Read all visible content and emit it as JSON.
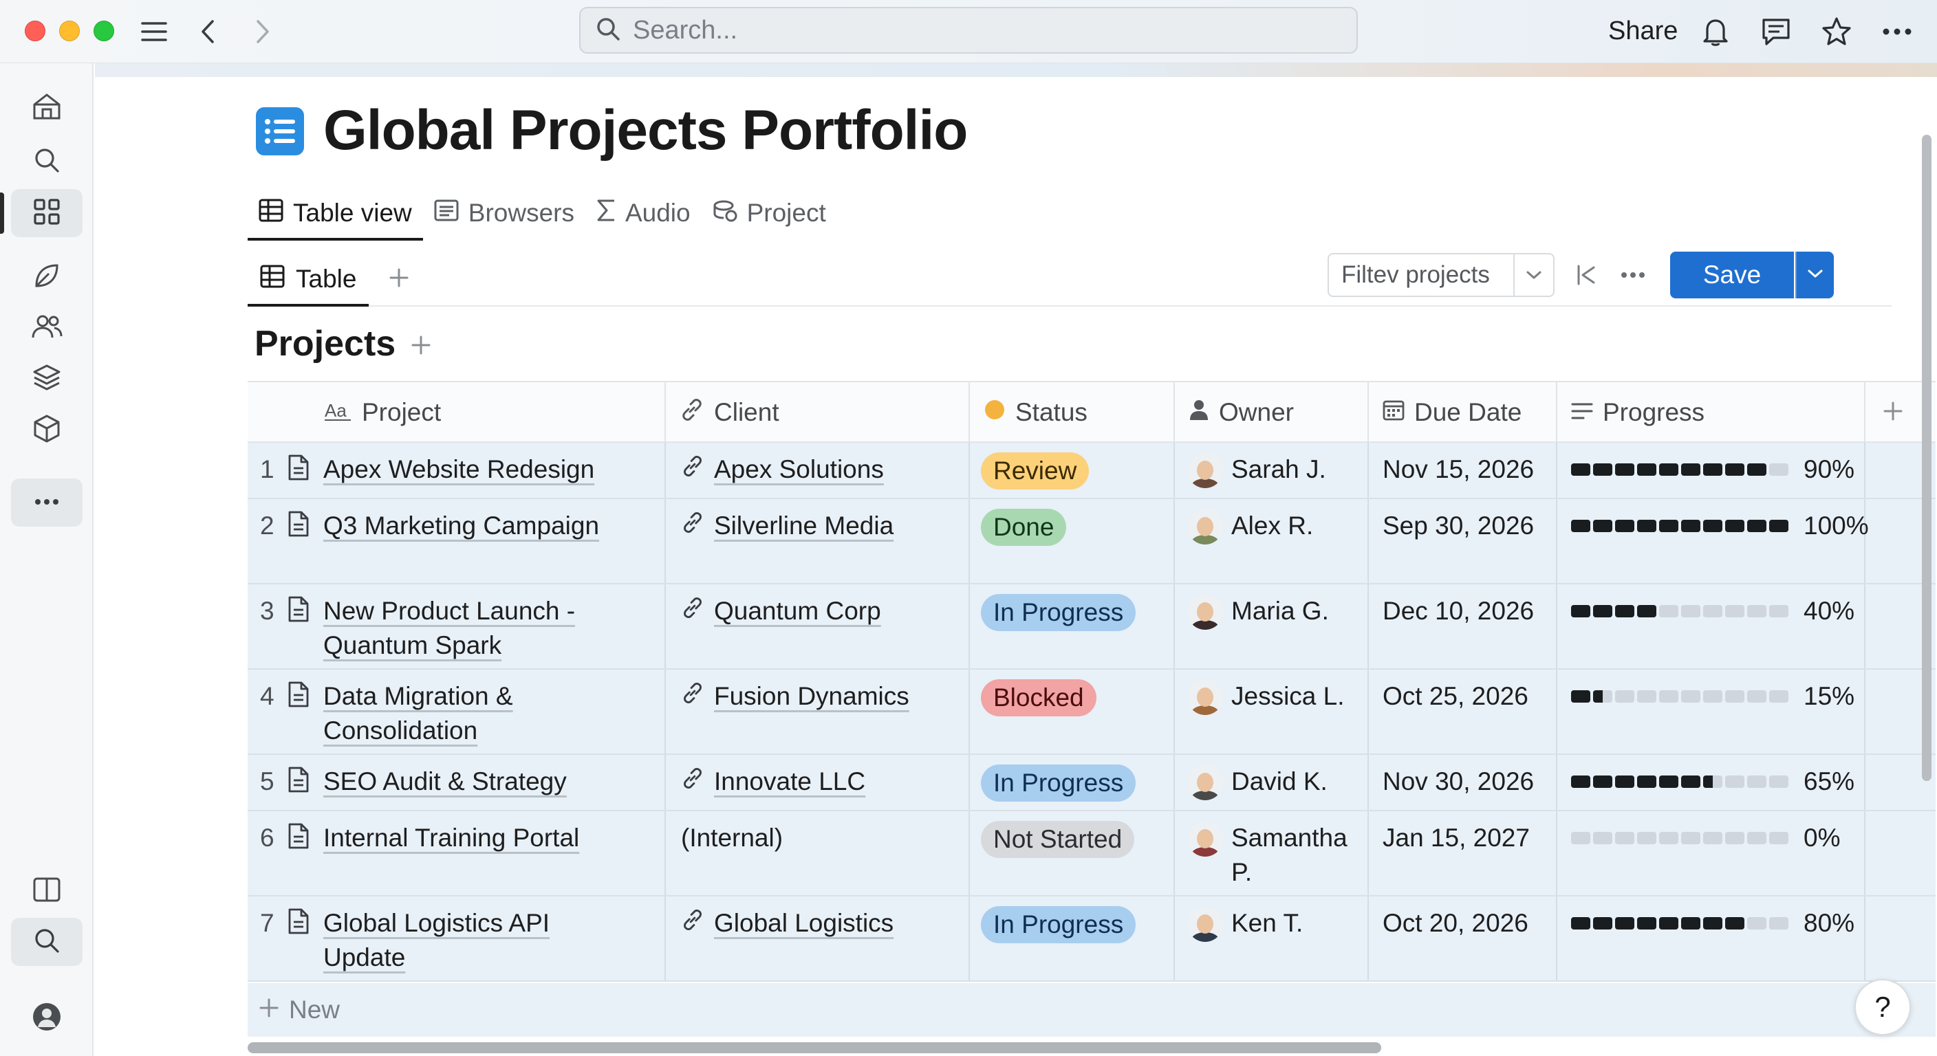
{
  "titlebar": {
    "search_placeholder": "Search...",
    "share_label": "Share"
  },
  "page": {
    "title": "Global Projects Portfolio",
    "views": [
      {
        "label": "Table view",
        "icon": "table-icon",
        "active": true
      },
      {
        "label": "Browsers",
        "icon": "browser-icon",
        "active": false
      },
      {
        "label": "Audio",
        "icon": "sigma-icon",
        "active": false
      },
      {
        "label": "Project",
        "icon": "stack-icon",
        "active": false
      }
    ],
    "subtab_label": "Table",
    "filter_label": "Filtev projects",
    "save_label": "Save",
    "section_title": "Projects"
  },
  "table": {
    "columns": [
      {
        "label": "Project",
        "icon": "text-aa-icon"
      },
      {
        "label": "Client",
        "icon": "link-icon"
      },
      {
        "label": "Status",
        "icon": "status-dot-icon"
      },
      {
        "label": "Owner",
        "icon": "person-icon"
      },
      {
        "label": "Due Date",
        "icon": "calendar-icon"
      },
      {
        "label": "Progress",
        "icon": "lines-icon"
      }
    ],
    "rows": [
      {
        "num": "1",
        "project": "Apex Website Redesign",
        "client": "Apex Solutions",
        "client_link": true,
        "status": "Review",
        "status_bg": "#fcd17a",
        "status_fg": "#3b2a00",
        "owner": "Sarah J.",
        "avatar_color": "#6b4a3a",
        "due": "Nov 15, 2026",
        "progress": 0.9,
        "progress_label": "90%"
      },
      {
        "num": "2",
        "project": "Q3 Marketing Campaign",
        "client": "Silverline Media",
        "client_link": true,
        "status": "Done",
        "status_bg": "#a8d8b0",
        "status_fg": "#12351a",
        "owner": "Alex R.",
        "avatar_color": "#7a8a5a",
        "due": "Sep 30, 2026",
        "progress": 1.0,
        "progress_label": "100%"
      },
      {
        "num": "3",
        "project": "New Product Launch - Quantum Spark",
        "client": "Quantum Corp",
        "client_link": true,
        "status": "In Progress",
        "status_bg": "#a7cdef",
        "status_fg": "#0e2f52",
        "owner": "Maria G.",
        "avatar_color": "#3a2b2b",
        "due": "Dec 10, 2026",
        "progress": 0.4,
        "progress_label": "40%"
      },
      {
        "num": "4",
        "project": "Data Migration & Consolidation",
        "client": "Fusion Dynamics",
        "client_link": true,
        "status": "Blocked",
        "status_bg": "#f2a3a3",
        "status_fg": "#4a0d0d",
        "owner": "Jessica L.",
        "avatar_color": "#a0683a",
        "due": "Oct 25, 2026",
        "progress": 0.15,
        "progress_label": "15%"
      },
      {
        "num": "5",
        "project": "SEO Audit & Strategy",
        "client": "Innovate LLC",
        "client_link": true,
        "status": "In Progress",
        "status_bg": "#a7cdef",
        "status_fg": "#0e2f52",
        "owner": "David K.",
        "avatar_color": "#4a4a4a",
        "due": "Nov 30, 2026",
        "progress": 0.65,
        "progress_label": "65%"
      },
      {
        "num": "6",
        "project": "Internal Training Portal",
        "client": "(Internal)",
        "client_link": false,
        "status": "Not Started",
        "status_bg": "#d7d9dc",
        "status_fg": "#2a2c2e",
        "owner": "Samantha P.",
        "avatar_color": "#8a3a3a",
        "due": "Jan 15, 2027",
        "progress": 0.0,
        "progress_label": "0%"
      },
      {
        "num": "7",
        "project": "Global Logistics API Update",
        "client": "Global Logistics",
        "client_link": true,
        "status": "In Progress",
        "status_bg": "#a7cdef",
        "status_fg": "#0e2f52",
        "owner": "Ken T.",
        "avatar_color": "#2f3b4a",
        "due": "Oct 20, 2026",
        "progress": 0.8,
        "progress_label": "80%"
      }
    ],
    "new_row_label": "New"
  },
  "help_label": "?"
}
